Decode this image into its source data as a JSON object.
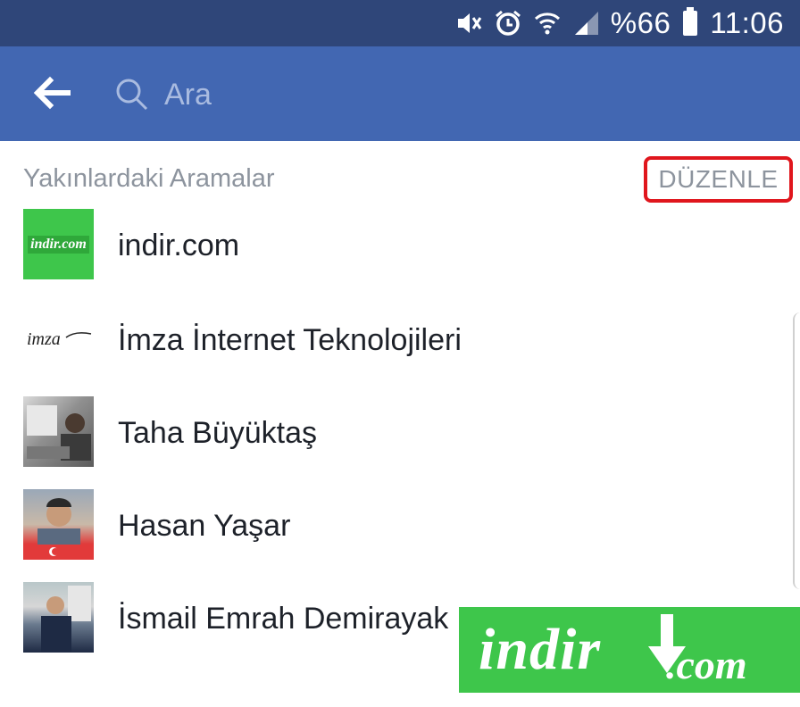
{
  "status_bar": {
    "battery": "%66",
    "time": "11:06",
    "icons": [
      "mute-vibrate-icon",
      "alarm-icon",
      "wifi-icon",
      "signal-icon",
      "battery-icon"
    ]
  },
  "search": {
    "placeholder": "Ara",
    "value": ""
  },
  "recent": {
    "title": "Yakınlardaki Aramalar",
    "edit_label": "DÜZENLE",
    "items": [
      {
        "label": "indir.com",
        "thumb_text": "indir.com"
      },
      {
        "label": "İmza İnternet Teknolojileri",
        "thumb_text": "imza"
      },
      {
        "label": "Taha Büyüktaş"
      },
      {
        "label": "Hasan Yaşar"
      },
      {
        "label": "İsmail Emrah Demirayak"
      }
    ]
  },
  "watermark": {
    "text": "indir",
    "suffix": ".com"
  },
  "colors": {
    "status_bar": "#2f4679",
    "app_bar": "#4267b2",
    "highlight": "#e0161d",
    "muted_text": "#8d949e",
    "brand_green": "#3ec64b"
  }
}
